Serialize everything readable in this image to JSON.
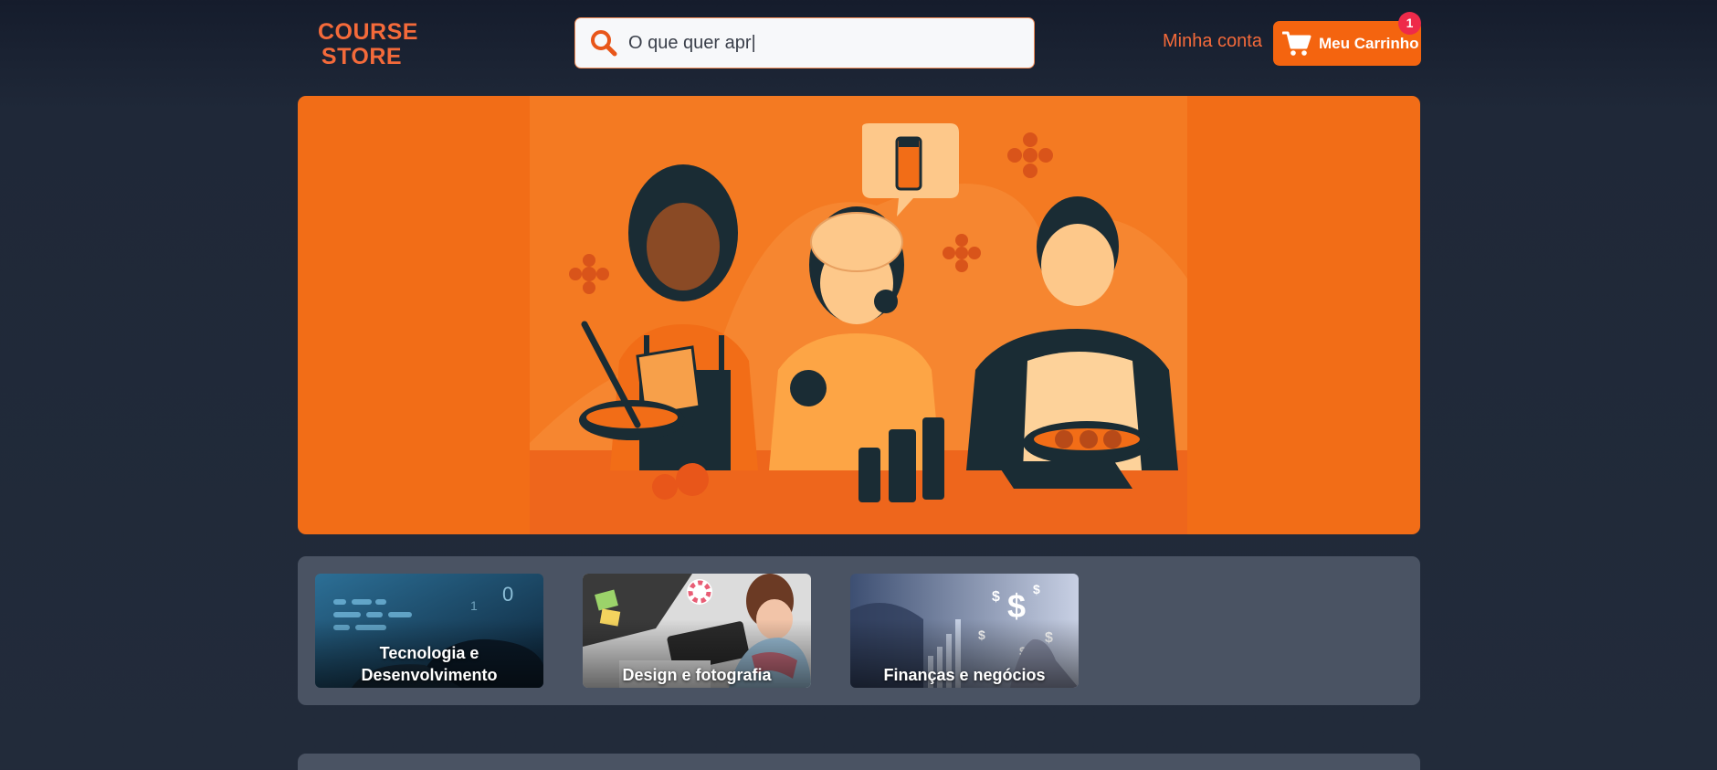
{
  "header": {
    "logo_line1": "COURSE",
    "logo_line2": "STORE",
    "search_value": "O que quer apr|",
    "search_icon": "search-icon",
    "account_label": "Minha conta",
    "cart_label": "Meu Carrinho",
    "cart_icon": "shopping-cart-icon",
    "cart_count": "1"
  },
  "hero": {
    "illustration": "cooking-and-beauty-course-illustration"
  },
  "categories": [
    {
      "label": "Tecnologia e Desenvolvimento",
      "image": "coding-keyboard-photo"
    },
    {
      "label": "Design e fotografia",
      "image": "designer-tablet-photo"
    },
    {
      "label": "Finanças e negócios",
      "image": "finance-dollar-photo"
    }
  ],
  "colors": {
    "accent": "#f4640f",
    "logo": "#f46a3a",
    "background": "#1f2838",
    "panel": "#4a5363",
    "badge": "#ee2a4a"
  }
}
